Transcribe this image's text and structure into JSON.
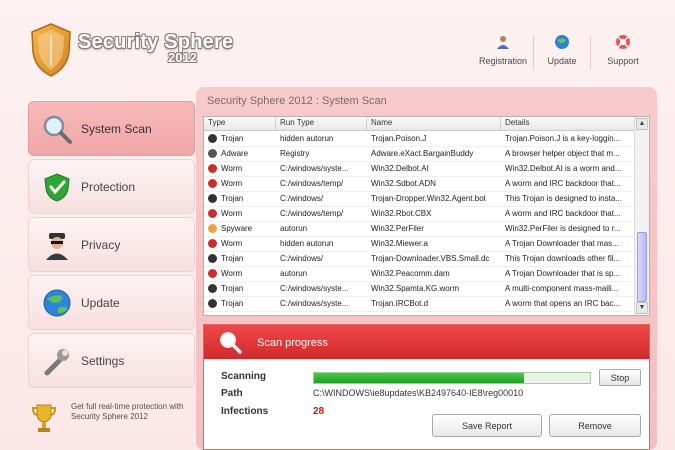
{
  "brand": {
    "title": "Security Sphere",
    "year": "2012"
  },
  "topnav": [
    {
      "label": "Registration",
      "icon": "registration-icon"
    },
    {
      "label": "Update",
      "icon": "update-globe-icon"
    },
    {
      "label": "Support",
      "icon": "support-icon"
    }
  ],
  "sidebar": {
    "items": [
      {
        "label": "System Scan",
        "icon": "magnifier-icon",
        "active": true
      },
      {
        "label": "Protection",
        "icon": "shield-check-icon",
        "active": false
      },
      {
        "label": "Privacy",
        "icon": "spy-icon",
        "active": false
      },
      {
        "label": "Update",
        "icon": "globe-icon",
        "active": false
      },
      {
        "label": "Settings",
        "icon": "wrench-icon",
        "active": false
      }
    ],
    "promo": "Get full real-time protection with Security Sphere 2012"
  },
  "panel": {
    "title": "Security Sphere 2012 : System Scan"
  },
  "table": {
    "columns": [
      "Type",
      "Run Type",
      "Name",
      "Details"
    ],
    "rows": [
      {
        "type": "Trojan",
        "run": "hidden autorun",
        "name": "Trojan.Poison.J",
        "details": "Trojan.Poison.J is a key-loggin..."
      },
      {
        "type": "Adware",
        "run": "Registry",
        "name": "Adware.eXact.BargainBuddy",
        "details": "A browser helper object that m..."
      },
      {
        "type": "Worm",
        "run": "C:/windows/syste...",
        "name": "Win32.Delbot.AI",
        "details": "Win32.Delbot.AI is a worm and..."
      },
      {
        "type": "Worm",
        "run": "C:/windows/temp/",
        "name": "Win32.Sdbot.ADN",
        "details": "A worm and IRC backdoor that..."
      },
      {
        "type": "Trojan",
        "run": "C:/windows/",
        "name": "Trojan-Dropper.Win32.Agent.bot",
        "details": "This Trojan is designed to insta..."
      },
      {
        "type": "Worm",
        "run": "C:/windows/temp/",
        "name": "Win32.Rbot.CBX",
        "details": "A worm and IRC backdoor that..."
      },
      {
        "type": "Spyware",
        "run": "autorun",
        "name": "Win32.PerFiler",
        "details": "Win32.PerFiler is designed to r..."
      },
      {
        "type": "Worm",
        "run": "hidden autorun",
        "name": "Win32.Miewer.a",
        "details": "A Trojan Downloader that mas..."
      },
      {
        "type": "Trojan",
        "run": "C:/windows/",
        "name": "Trojan-Downloader.VBS.Small.dc",
        "details": "This Trojan downloads other fil..."
      },
      {
        "type": "Worm",
        "run": "autorun",
        "name": "Win32.Peacomm.dam",
        "details": "A Trojan Downloader that is sp..."
      },
      {
        "type": "Trojan",
        "run": "C:/windows/syste...",
        "name": "Win32.Spamta.KG.worm",
        "details": "A multi-component mass-maili..."
      },
      {
        "type": "Trojan",
        "run": "C:/windows/syste...",
        "name": "Trojan.IRCBot.d",
        "details": "A worm that opens an IRC bac..."
      }
    ]
  },
  "progress": {
    "title": "Scan progress",
    "scanning_label": "Scanning",
    "scan_fraction": 0.76,
    "stop_label": "Stop",
    "path_label": "Path",
    "path_value": "C:\\WINDOWS\\ie8updates\\KB2497640-IE8\\reg00010",
    "infections_label": "Infections",
    "infections_value": "28",
    "save_label": "Save Report",
    "remove_label": "Remove"
  },
  "colors": {
    "accent_red": "#e03333",
    "scan_green": "#27b12a"
  }
}
